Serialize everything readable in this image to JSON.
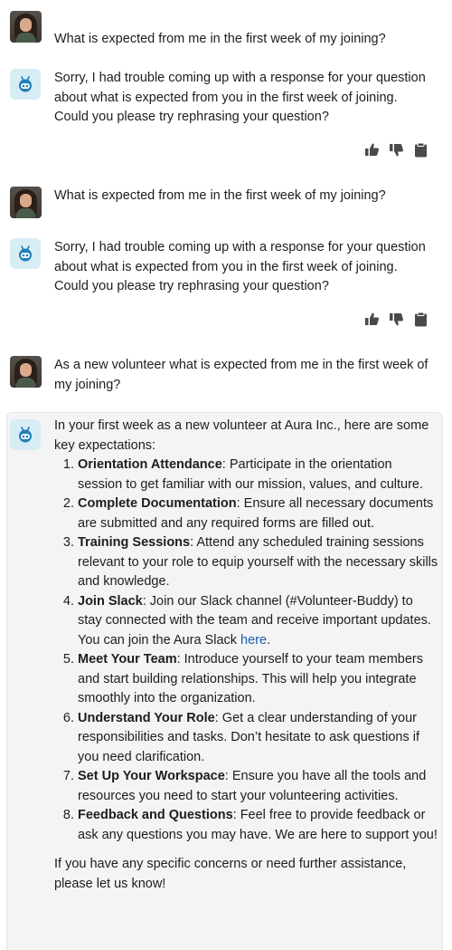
{
  "messages": [
    {
      "role": "user",
      "text": "What is expected from me in the first week of my joining?"
    },
    {
      "role": "bot",
      "text": "Sorry, I had trouble coming up with a response for your question about what is expected from you in the first week of joining. Could you please try rephrasing your question?"
    },
    {
      "role": "user",
      "text": "What is expected from me in the first week of my joining?"
    },
    {
      "role": "bot",
      "text": "Sorry, I had trouble coming up with a response for your question about what is expected from you in the first week of joining. Could you please try rephrasing your question?"
    },
    {
      "role": "user",
      "text": "As a new volunteer what is expected from me in the first week of my joining?"
    }
  ],
  "response": {
    "intro": "In your first week as a new volunteer at Aura Inc., here are some key expectations:",
    "items": [
      {
        "title": "Orientation Attendance",
        "text": ": Participate in the orientation session to get familiar with our mission, values, and culture."
      },
      {
        "title": "Complete Documentation",
        "text": ": Ensure all necessary documents are submitted and any required forms are filled out."
      },
      {
        "title": "Training Sessions",
        "text": ": Attend any scheduled training sessions relevant to your role to equip yourself with the necessary skills and knowledge."
      },
      {
        "title": "Join Slack",
        "text": ": Join our Slack channel (#Volunteer-Buddy) to stay connected with the team and receive important updates. You can join the Aura Slack ",
        "link": "here",
        "after": "."
      },
      {
        "title": "Meet Your Team",
        "text": ": Introduce yourself to your team members and start building relationships. This will help you integrate smoothly into the organization."
      },
      {
        "title": "Understand Your Role",
        "text": ": Get a clear understanding of your responsibilities and tasks. Don’t hesitate to ask questions if you need clarification."
      },
      {
        "title": "Set Up Your Workspace",
        "text": ": Ensure you have all the tools and resources you need to start your volunteering activities."
      },
      {
        "title": "Feedback and Questions",
        "text": ": Feel free to provide feedback or ask any questions you may have. We are here to support you!"
      }
    ],
    "outro": "If you have any specific concerns or need further assistance, please let us know!"
  },
  "icons": {
    "user_avatar": "user-avatar-photo",
    "bot_avatar": "robot-icon",
    "feedback": [
      "thumbs-up-icon",
      "thumbs-down-icon",
      "clipboard-icon"
    ]
  },
  "colors": {
    "bot_avatar_bg": "#d8ecf6",
    "bot_icon": "#1f7fb8",
    "link": "#1a5fa8",
    "card_bg": "#f4f4f4",
    "feedback_icon": "#4a4a4a"
  }
}
